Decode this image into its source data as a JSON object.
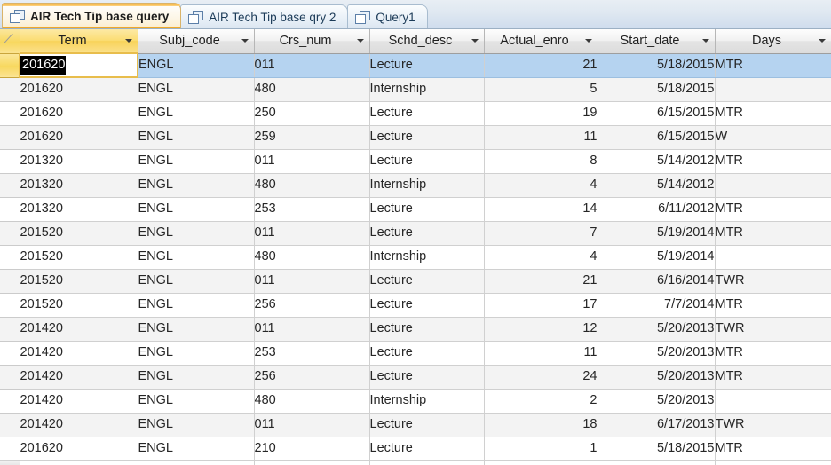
{
  "tabs": [
    {
      "label": "AIR Tech Tip base query",
      "active": true,
      "icon": "query-datasheet-icon"
    },
    {
      "label": "AIR Tech Tip base qry 2",
      "active": false,
      "icon": "query-datasheet-icon"
    },
    {
      "label": "Query1",
      "active": false,
      "icon": "query-datasheet-icon"
    }
  ],
  "datasheet": {
    "selected_column": "Term",
    "current_row_index": 0,
    "editing_cell": {
      "row": 0,
      "column": "Term",
      "value": "201620",
      "text_selected": true
    },
    "columns": [
      {
        "key": "term",
        "label": "Term",
        "align": "left",
        "width": 133
      },
      {
        "key": "subj_code",
        "label": "Subj_code",
        "align": "left",
        "width": 131
      },
      {
        "key": "crs_num",
        "label": "Crs_num",
        "align": "left",
        "width": 130
      },
      {
        "key": "schd_desc",
        "label": "Schd_desc",
        "align": "left",
        "width": 129
      },
      {
        "key": "actual_enro",
        "label": "Actual_enro",
        "align": "right",
        "width": 128
      },
      {
        "key": "start_date",
        "label": "Start_date",
        "align": "right",
        "width": 132
      },
      {
        "key": "days",
        "label": "Days",
        "align": "left",
        "width": 131
      }
    ],
    "rows": [
      {
        "term": "201620",
        "subj_code": "ENGL",
        "crs_num": "011",
        "schd_desc": "Lecture",
        "actual_enro": "21",
        "start_date": "5/18/2015",
        "days": "MTR"
      },
      {
        "term": "201620",
        "subj_code": "ENGL",
        "crs_num": "480",
        "schd_desc": "Internship",
        "actual_enro": "5",
        "start_date": "5/18/2015",
        "days": ""
      },
      {
        "term": "201620",
        "subj_code": "ENGL",
        "crs_num": "250",
        "schd_desc": "Lecture",
        "actual_enro": "19",
        "start_date": "6/15/2015",
        "days": "MTR"
      },
      {
        "term": "201620",
        "subj_code": "ENGL",
        "crs_num": "259",
        "schd_desc": "Lecture",
        "actual_enro": "11",
        "start_date": "6/15/2015",
        "days": "W"
      },
      {
        "term": "201320",
        "subj_code": "ENGL",
        "crs_num": "011",
        "schd_desc": "Lecture",
        "actual_enro": "8",
        "start_date": "5/14/2012",
        "days": "MTR"
      },
      {
        "term": "201320",
        "subj_code": "ENGL",
        "crs_num": "480",
        "schd_desc": "Internship",
        "actual_enro": "4",
        "start_date": "5/14/2012",
        "days": ""
      },
      {
        "term": "201320",
        "subj_code": "ENGL",
        "crs_num": "253",
        "schd_desc": "Lecture",
        "actual_enro": "14",
        "start_date": "6/11/2012",
        "days": "MTR"
      },
      {
        "term": "201520",
        "subj_code": "ENGL",
        "crs_num": "011",
        "schd_desc": "Lecture",
        "actual_enro": "7",
        "start_date": "5/19/2014",
        "days": "MTR"
      },
      {
        "term": "201520",
        "subj_code": "ENGL",
        "crs_num": "480",
        "schd_desc": "Internship",
        "actual_enro": "4",
        "start_date": "5/19/2014",
        "days": ""
      },
      {
        "term": "201520",
        "subj_code": "ENGL",
        "crs_num": "011",
        "schd_desc": "Lecture",
        "actual_enro": "21",
        "start_date": "6/16/2014",
        "days": "TWR"
      },
      {
        "term": "201520",
        "subj_code": "ENGL",
        "crs_num": "256",
        "schd_desc": "Lecture",
        "actual_enro": "17",
        "start_date": "7/7/2014",
        "days": "MTR"
      },
      {
        "term": "201420",
        "subj_code": "ENGL",
        "crs_num": "011",
        "schd_desc": "Lecture",
        "actual_enro": "12",
        "start_date": "5/20/2013",
        "days": "TWR"
      },
      {
        "term": "201420",
        "subj_code": "ENGL",
        "crs_num": "253",
        "schd_desc": "Lecture",
        "actual_enro": "11",
        "start_date": "5/20/2013",
        "days": "MTR"
      },
      {
        "term": "201420",
        "subj_code": "ENGL",
        "crs_num": "256",
        "schd_desc": "Lecture",
        "actual_enro": "24",
        "start_date": "5/20/2013",
        "days": "MTR"
      },
      {
        "term": "201420",
        "subj_code": "ENGL",
        "crs_num": "480",
        "schd_desc": "Internship",
        "actual_enro": "2",
        "start_date": "5/20/2013",
        "days": ""
      },
      {
        "term": "201420",
        "subj_code": "ENGL",
        "crs_num": "011",
        "schd_desc": "Lecture",
        "actual_enro": "18",
        "start_date": "6/17/2013",
        "days": "TWR"
      },
      {
        "term": "201620",
        "subj_code": "ENGL",
        "crs_num": "210",
        "schd_desc": "Lecture",
        "actual_enro": "1",
        "start_date": "5/18/2015",
        "days": "MTR"
      }
    ]
  },
  "colors": {
    "selection_blue": "#b5d3f0",
    "selected_header_gold": "#f8d35a",
    "edit_border_gold": "#e8bd4c",
    "alt_row": "#f3f3f3",
    "grid_line": "#d0d0d0"
  }
}
